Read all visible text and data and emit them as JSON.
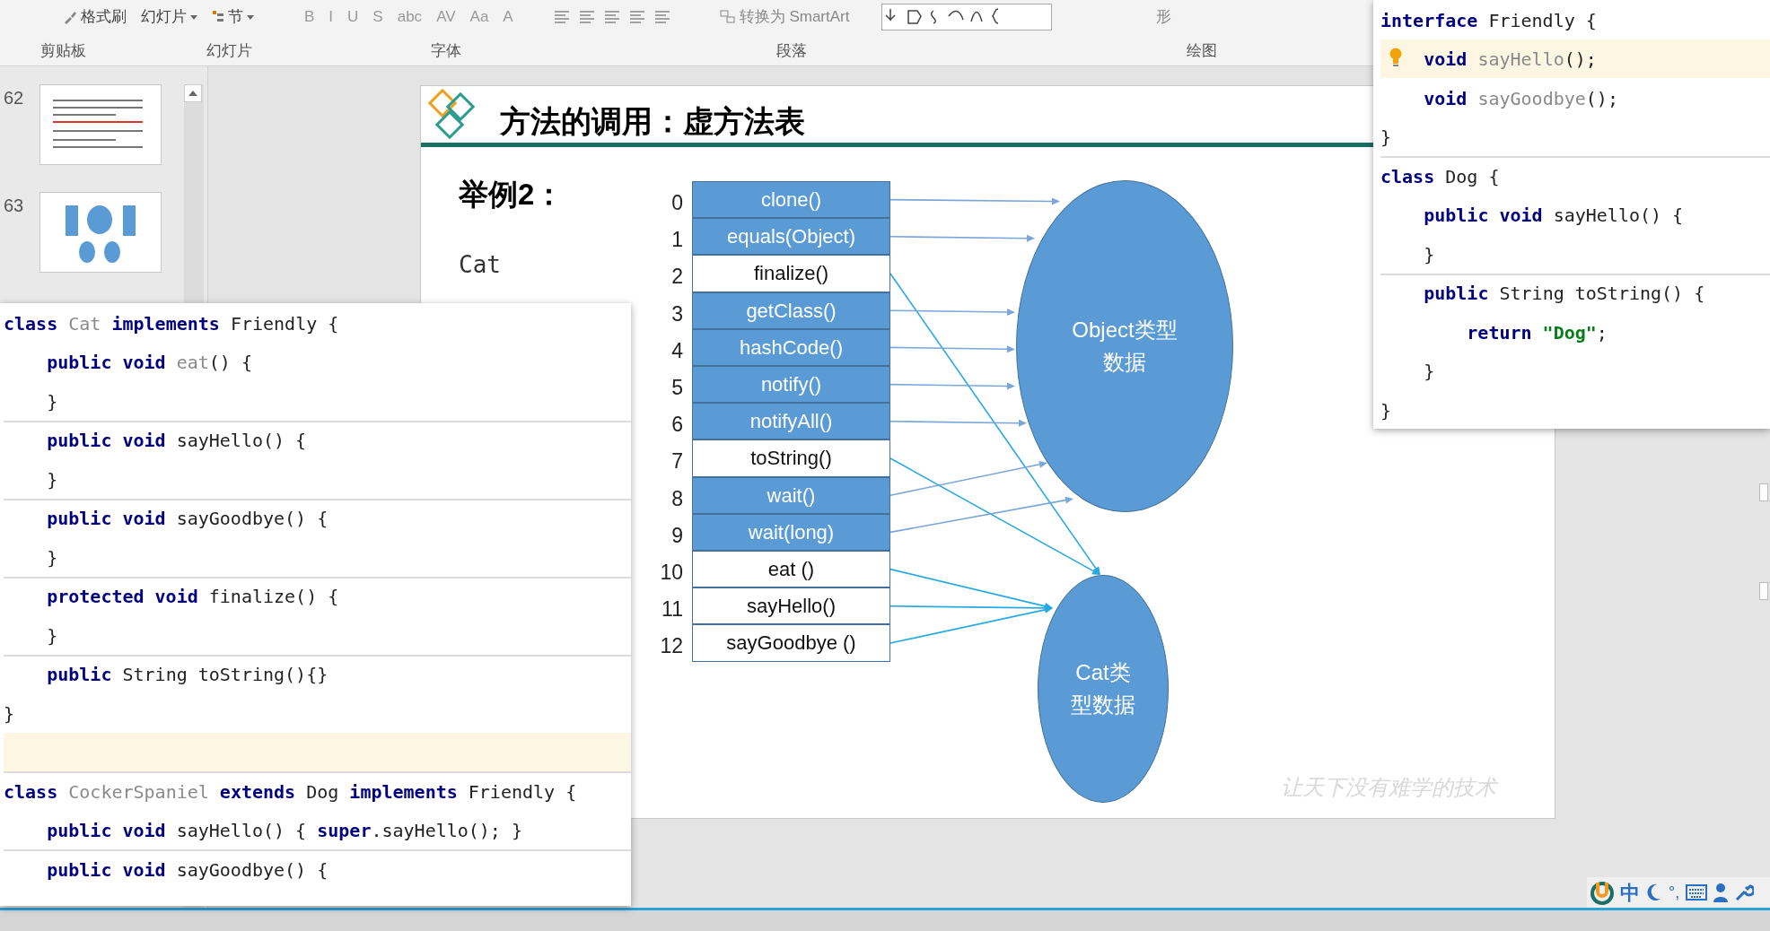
{
  "ribbon": {
    "top_items": [
      {
        "kind": "brush",
        "label": "格式刷"
      },
      {
        "kind": "dropdown",
        "label": "幻灯片"
      },
      {
        "kind": "section",
        "label": "节"
      }
    ],
    "font_buttons": [
      "B",
      "I",
      "U",
      "S",
      "abc",
      "AV",
      "Aa",
      "A"
    ],
    "smartart": "转换为 SmartArt",
    "shape_label": "形",
    "groups": [
      "剪贴板",
      "幻灯片",
      "字体",
      "段落",
      "绘图"
    ]
  },
  "thumbnails": [
    {
      "number": "62",
      "kind": "text"
    },
    {
      "number": "63",
      "kind": "diagram"
    }
  ],
  "slide": {
    "title": "方法的调用：虚方法表",
    "example": "举例2：",
    "class_name": "Cat",
    "rows": [
      {
        "index": "0",
        "label": "clone()",
        "shaded": true
      },
      {
        "index": "1",
        "label": "equals(Object)",
        "shaded": true
      },
      {
        "index": "2",
        "label": "finalize()",
        "shaded": false
      },
      {
        "index": "3",
        "label": "getClass()",
        "shaded": true
      },
      {
        "index": "4",
        "label": "hashCode()",
        "shaded": true
      },
      {
        "index": "5",
        "label": "notify()",
        "shaded": true
      },
      {
        "index": "6",
        "label": "notifyAll()",
        "shaded": true
      },
      {
        "index": "7",
        "label": "toString()",
        "shaded": false
      },
      {
        "index": "8",
        "label": "wait()",
        "shaded": true
      },
      {
        "index": "9",
        "label": "wait(long)",
        "shaded": true
      },
      {
        "index": "10",
        "label": "eat ()",
        "shaded": false
      },
      {
        "index": "11",
        "label": "sayHello()",
        "shaded": false
      },
      {
        "index": "12",
        "label": "sayGoodbye ()",
        "shaded": false
      }
    ],
    "object_node": "Object类型数据",
    "cat_node": "Cat类型数据",
    "watermark": "让天下没有难学的技术"
  },
  "left_code": [
    {
      "tokens": [
        {
          "t": "class",
          "kind": "keyword"
        },
        {
          "t": " Cat",
          "kind": "unused"
        },
        {
          "t": " implements",
          "kind": "keyword"
        },
        {
          "t": " Friendly {",
          "kind": "plain"
        }
      ]
    },
    {
      "tokens": [
        {
          "t": "    public void",
          "kind": "keyword"
        },
        {
          "t": " eat",
          "kind": "unused"
        },
        {
          "t": "() {",
          "kind": "plain"
        }
      ]
    },
    {
      "tokens": [
        {
          "t": "    }",
          "kind": "plain"
        }
      ]
    },
    {
      "rule_above": true,
      "tokens": [
        {
          "t": "    public void",
          "kind": "keyword"
        },
        {
          "t": " sayHello() {",
          "kind": "plain"
        }
      ]
    },
    {
      "tokens": [
        {
          "t": "    }",
          "kind": "plain"
        }
      ]
    },
    {
      "rule_above": true,
      "tokens": [
        {
          "t": "    public void",
          "kind": "keyword"
        },
        {
          "t": " sayGoodbye() {",
          "kind": "plain"
        }
      ]
    },
    {
      "tokens": [
        {
          "t": "    }",
          "kind": "plain"
        }
      ]
    },
    {
      "rule_above": true,
      "tokens": [
        {
          "t": "    protected void",
          "kind": "keyword"
        },
        {
          "t": " finalize() {",
          "kind": "plain"
        }
      ]
    },
    {
      "tokens": [
        {
          "t": "    }",
          "kind": "plain"
        }
      ]
    },
    {
      "rule_above": true,
      "tokens": [
        {
          "t": "    public",
          "kind": "keyword"
        },
        {
          "t": " String toString(){}",
          "kind": "plain"
        }
      ]
    },
    {
      "tokens": [
        {
          "t": "}",
          "kind": "plain"
        }
      ]
    },
    {
      "highlighted": true
    },
    {
      "rule_above": true,
      "tokens": [
        {
          "t": "class",
          "kind": "keyword"
        },
        {
          "t": " CockerSpaniel",
          "kind": "unused"
        },
        {
          "t": " extends",
          "kind": "keyword"
        },
        {
          "t": " Dog",
          "kind": "plain"
        },
        {
          "t": " implements",
          "kind": "keyword"
        },
        {
          "t": " Friendly {",
          "kind": "plain"
        }
      ]
    },
    {
      "tokens": [
        {
          "t": "    public void",
          "kind": "keyword"
        },
        {
          "t": " sayHello() {",
          "kind": "plain"
        },
        {
          "t": " super",
          "kind": "keyword"
        },
        {
          "t": ".sayHello(); }",
          "kind": "plain"
        }
      ]
    },
    {
      "rule_above": true,
      "tokens": [
        {
          "t": "    public void",
          "kind": "keyword"
        },
        {
          "t": " sayGoodbye() {",
          "kind": "plain"
        }
      ]
    }
  ],
  "right_code": [
    {
      "tokens": [
        {
          "t": "interface",
          "kind": "keyword"
        },
        {
          "t": " Friendly {",
          "kind": "plain"
        }
      ]
    },
    {
      "highlighted": true,
      "bulb": true,
      "tokens": [
        {
          "t": "    void",
          "kind": "keyword"
        },
        {
          "t": " sayHello",
          "kind": "unused"
        },
        {
          "t": "();",
          "kind": "plain"
        }
      ]
    },
    {
      "tokens": [
        {
          "t": "    void",
          "kind": "keyword"
        },
        {
          "t": " sayGoodbye",
          "kind": "unused"
        },
        {
          "t": "();",
          "kind": "plain"
        }
      ]
    },
    {
      "tokens": [
        {
          "t": "}",
          "kind": "plain"
        }
      ]
    },
    {
      "rule_above": true,
      "tokens": [
        {
          "t": "class",
          "kind": "keyword"
        },
        {
          "t": " Dog {",
          "kind": "plain"
        }
      ]
    },
    {
      "tokens": [
        {
          "t": "    public void",
          "kind": "keyword"
        },
        {
          "t": " sayHello() {",
          "kind": "plain"
        }
      ]
    },
    {
      "tokens": [
        {
          "t": "    }",
          "kind": "plain"
        }
      ]
    },
    {
      "rule_above": true,
      "tokens": [
        {
          "t": "    public",
          "kind": "keyword"
        },
        {
          "t": " String toString() {",
          "kind": "plain"
        }
      ]
    },
    {
      "tokens": [
        {
          "t": "        return",
          "kind": "keyword"
        },
        {
          "t": " \"Dog\"",
          "kind": "string"
        },
        {
          "t": ";",
          "kind": "plain"
        }
      ]
    },
    {
      "tokens": [
        {
          "t": "    }",
          "kind": "plain"
        }
      ]
    },
    {
      "tokens": [
        {
          "t": "}",
          "kind": "plain"
        }
      ]
    }
  ],
  "ime": {
    "mode": "中",
    "punct": "°,"
  }
}
